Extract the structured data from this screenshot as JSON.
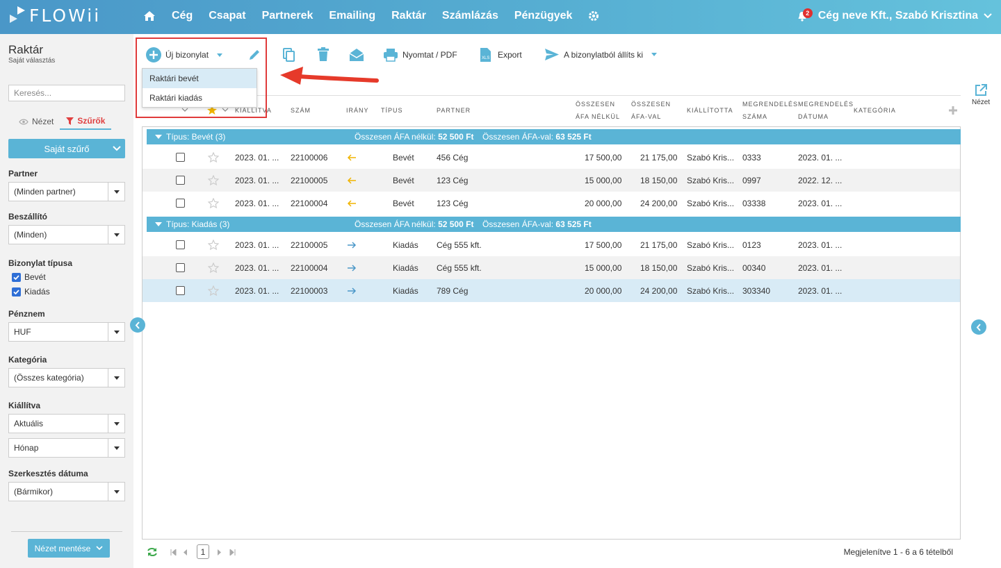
{
  "app": {
    "logo": "FLOWii"
  },
  "nav": {
    "items": [
      "Cég",
      "Csapat",
      "Partnerek",
      "Emailing",
      "Raktár",
      "Számlázás",
      "Pénzügyek"
    ],
    "notifications": "2",
    "user": "Cég neve Kft., Szabó Krisztina"
  },
  "sidebar": {
    "title": "Raktár",
    "subtitle": "Saját választás",
    "search_placeholder": "Keresés...",
    "tab_view": "Nézet",
    "tab_filters": "Szűrők",
    "own_filter": "Saját szűrő",
    "partner_label": "Partner",
    "partner_value": "(Minden partner)",
    "supplier_label": "Beszállító",
    "supplier_value": "(Minden)",
    "doctype_label": "Bizonylat típusa",
    "doctype_in": "Bevét",
    "doctype_out": "Kiadás",
    "currency_label": "Pénznem",
    "currency_value": "HUF",
    "category_label": "Kategória",
    "category_value": "(Összes kategória)",
    "issued_label": "Kiállítva",
    "issued_value": "Aktuális",
    "issued_period": "Hónap",
    "edited_label": "Szerkesztés dátuma",
    "edited_value": "(Bármikor)",
    "save_view": "Nézet mentése"
  },
  "toolbar": {
    "new_doc": "Új bizonylat",
    "print": "Nyomtat / PDF",
    "export": "Export",
    "create_from": "A bizonylatból állíts ki"
  },
  "dropdown": {
    "items": [
      "Raktári bevét",
      "Raktári kiadás"
    ]
  },
  "side": {
    "view_label": "Nézet"
  },
  "columns": {
    "issued": "KIÁLLÍTVA",
    "number": "SZÁM",
    "direction": "IRÁNY",
    "type": "TÍPUS",
    "partner": "PARTNER",
    "net_1": "ÖSSZESEN",
    "net_2": "ÁFA NÉLKÜL",
    "gross_1": "ÖSSZESEN",
    "gross_2": "ÁFA-VAL",
    "issuer": "KIÁLLÍTOTTA",
    "order_no_1": "MEGRENDELÉS",
    "order_no_2": "SZÁMA",
    "order_date_1": "MEGRENDELÉS",
    "order_date_2": "DÁTUMA",
    "category": "KATEGÓRIA"
  },
  "groups": [
    {
      "title": "Típus: Bevét (3)",
      "net_label": "Összesen ÁFA nélkül:",
      "net": "52 500 Ft",
      "gross_label": "Összesen ÁFA-val:",
      "gross": "63 525 Ft",
      "rows": [
        {
          "issued": "2023. 01. ...",
          "number": "22100006",
          "type": "Bevét",
          "partner": "456 Cég",
          "net": "17 500,00",
          "gross": "21 175,00",
          "issuer": "Szabó Kris...",
          "order_no": "0333",
          "order_date": "2023. 01. ..."
        },
        {
          "issued": "2023. 01. ...",
          "number": "22100005",
          "type": "Bevét",
          "partner": "123 Cég",
          "net": "15 000,00",
          "gross": "18 150,00",
          "issuer": "Szabó Kris...",
          "order_no": "0997",
          "order_date": "2022. 12. ..."
        },
        {
          "issued": "2023. 01. ...",
          "number": "22100004",
          "type": "Bevét",
          "partner": "123 Cég",
          "net": "20 000,00",
          "gross": "24 200,00",
          "issuer": "Szabó Kris...",
          "order_no": "03338",
          "order_date": "2023. 01. ..."
        }
      ]
    },
    {
      "title": "Típus: Kiadás (3)",
      "net_label": "Összesen ÁFA nélkül:",
      "net": "52 500 Ft",
      "gross_label": "Összesen ÁFA-val:",
      "gross": "63 525 Ft",
      "rows": [
        {
          "issued": "2023. 01. ...",
          "number": "22100005",
          "type": "Kiadás",
          "partner": "Cég 555 kft.",
          "net": "17 500,00",
          "gross": "21 175,00",
          "issuer": "Szabó Kris...",
          "order_no": "0123",
          "order_date": "2023. 01. ..."
        },
        {
          "issued": "2023. 01. ...",
          "number": "22100004",
          "type": "Kiadás",
          "partner": "Cég 555 kft.",
          "net": "15 000,00",
          "gross": "18 150,00",
          "issuer": "Szabó Kris...",
          "order_no": "00340",
          "order_date": "2023. 01. ..."
        },
        {
          "issued": "2023. 01. ...",
          "number": "22100003",
          "type": "Kiadás",
          "partner": "789 Cég",
          "net": "20 000,00",
          "gross": "24 200,00",
          "issuer": "Szabó Kris...",
          "order_no": "303340",
          "order_date": "2023. 01. ..."
        }
      ]
    }
  ],
  "pager": {
    "page": "1",
    "summary": "Megjelenítve 1 - 6 a 6 tételből"
  },
  "colors": {
    "accent": "#5ab4d6",
    "highlight": "#e03a3a",
    "incoming": "#f0b400",
    "outgoing": "#4a97c8"
  }
}
